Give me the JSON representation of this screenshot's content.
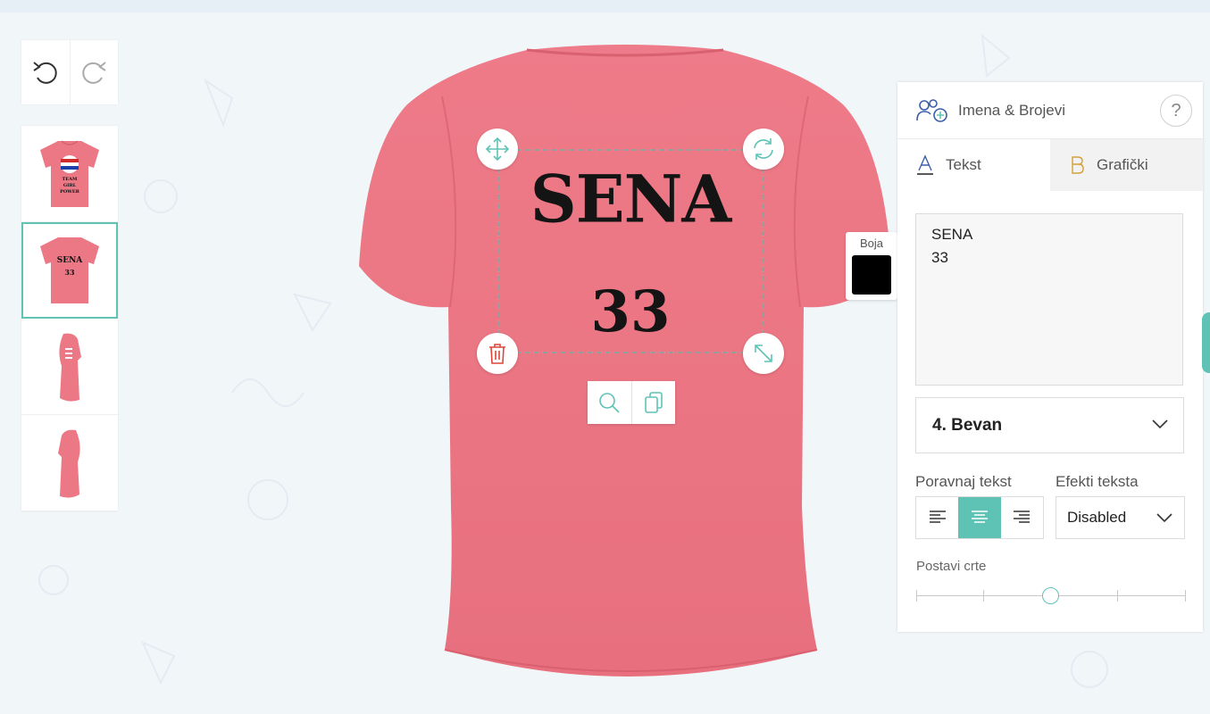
{
  "toolbar": {
    "undo_icon": "undo-icon",
    "redo_icon": "redo-icon"
  },
  "views": [
    {
      "name": "front",
      "lines": [
        "TEAM",
        "GIRL",
        "POWER"
      ]
    },
    {
      "name": "back",
      "lines": [
        "SENA",
        "33"
      ],
      "active": true
    },
    {
      "name": "left-sleeve"
    },
    {
      "name": "right-sleeve"
    }
  ],
  "design": {
    "line1": "SENA",
    "line2": "33"
  },
  "shirt": {
    "color": "#ec7886"
  },
  "color_picker": {
    "label": "Boja",
    "value": "#000000"
  },
  "panel": {
    "title": "Imena & Brojevi",
    "help": "?",
    "tabs": [
      {
        "label": "Tekst",
        "active": true
      },
      {
        "label": "Grafički",
        "active": false
      }
    ],
    "text_value": "SENA\n33",
    "font": "4. Bevan",
    "align_label": "Poravnaj tekst",
    "align_selected": "center",
    "effects_label": "Efekti teksta",
    "effects_value": "Disabled",
    "lines_label": "Postavi crte",
    "lines_value": 0.5
  },
  "accent_color": "#5ec3b5"
}
